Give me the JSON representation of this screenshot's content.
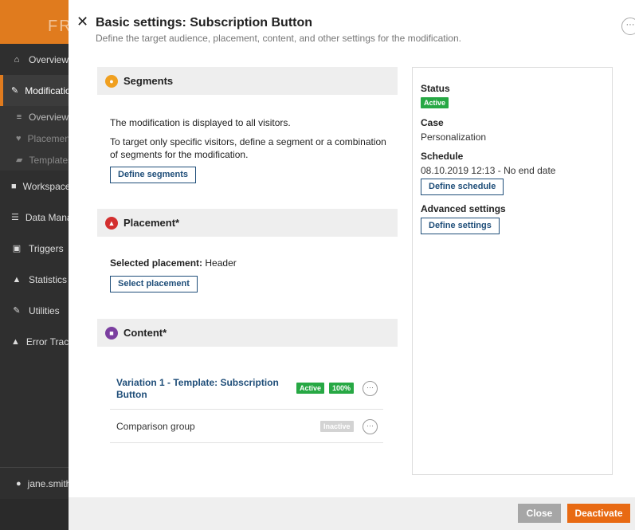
{
  "sidebar": {
    "logo": "FR",
    "items": [
      {
        "icon": "home-icon",
        "glyph": "⌂",
        "label": "Overview"
      },
      {
        "icon": "edit-icon",
        "glyph": "✎",
        "label": "Modifications"
      },
      {
        "icon": "list-icon",
        "glyph": "≡",
        "label": "Overview"
      },
      {
        "icon": "pin-icon",
        "glyph": "♥",
        "label": "Placements"
      },
      {
        "icon": "template-icon",
        "glyph": "▰",
        "label": "Templates"
      },
      {
        "icon": "lock-icon",
        "glyph": "🔒",
        "label": "Workspaces"
      },
      {
        "icon": "database-icon",
        "glyph": "☰",
        "label": "Data Management"
      },
      {
        "icon": "trigger-icon",
        "glyph": "▣",
        "label": "Triggers"
      },
      {
        "icon": "chart-icon",
        "glyph": "▲",
        "label": "Statistics"
      },
      {
        "icon": "wrench-icon",
        "glyph": "✎",
        "label": "Utilities"
      },
      {
        "icon": "warning-icon",
        "glyph": "▲",
        "label": "Error Tracking"
      }
    ],
    "user": "jane.smith"
  },
  "modal": {
    "title": "Basic settings: Subscription Button",
    "subtitle": "Define the target audience, placement, content, and other settings for the modification."
  },
  "segments": {
    "heading": "Segments",
    "line1": "The modification is displayed to all visitors.",
    "line2": "To target only specific visitors, define a segment or a combination of segments for the modification.",
    "button": "Define segments"
  },
  "placement": {
    "heading": "Placement*",
    "selected_label": "Selected placement:",
    "selected_value": "Header",
    "button": "Select placement"
  },
  "content": {
    "heading": "Content*",
    "variations": [
      {
        "title": "Variation 1 - Template: Subscription Button",
        "status": "Active",
        "share": "100%"
      },
      {
        "title": "Comparison group",
        "status": "Inactive"
      }
    ]
  },
  "panel": {
    "status_label": "Status",
    "status_value": "Active",
    "case_label": "Case",
    "case_value": "Personalization",
    "schedule_label": "Schedule",
    "schedule_value": "08.10.2019 12:13 - No end date",
    "schedule_button": "Define schedule",
    "advanced_label": "Advanced settings",
    "advanced_button": "Define settings"
  },
  "footer": {
    "close": "Close",
    "deactivate": "Deactivate"
  },
  "colors": {
    "accent": "#e07b1e",
    "primary_text": "#1f4e79",
    "active_green": "#27a844",
    "deactivate": "#e86a13"
  }
}
